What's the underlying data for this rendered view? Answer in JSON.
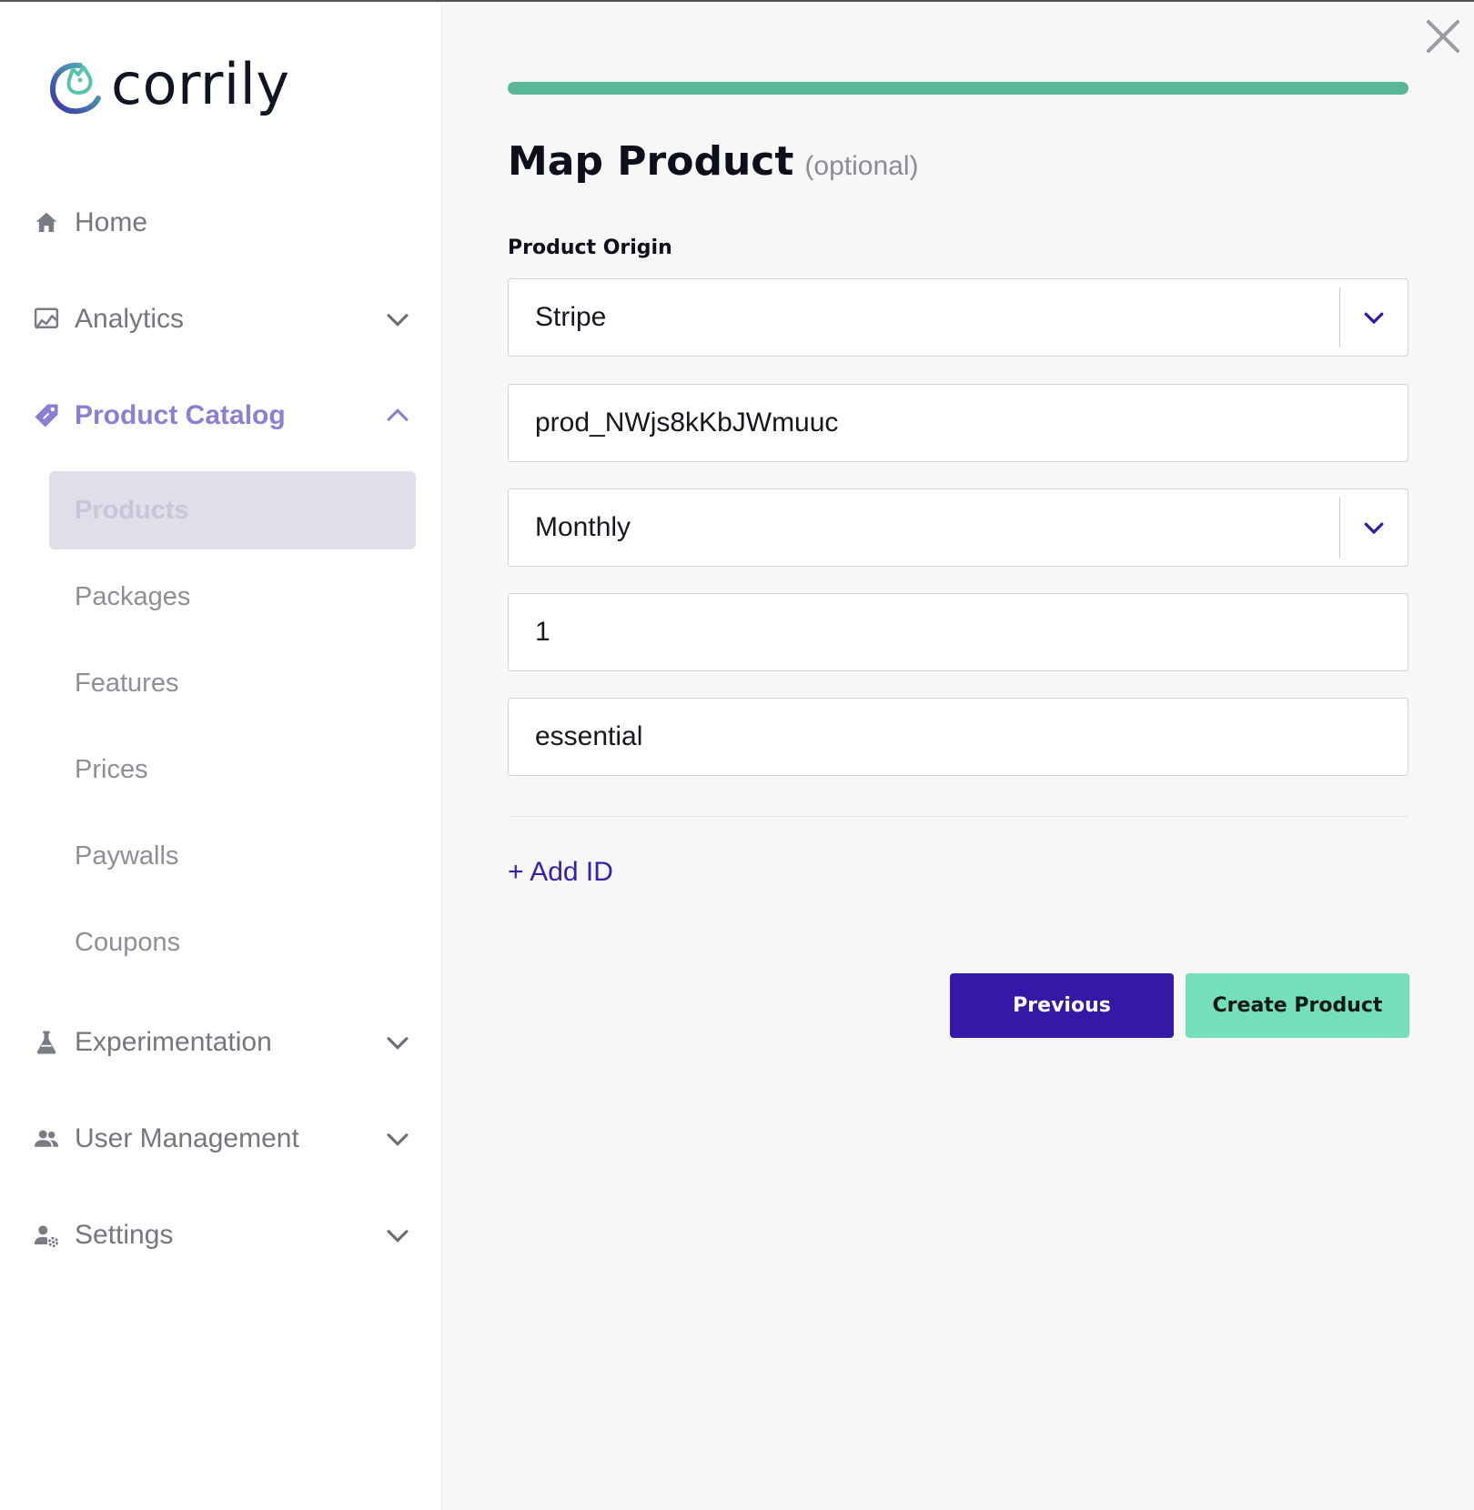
{
  "brand": {
    "name": "corrily"
  },
  "sidebar": {
    "items": [
      {
        "label": "Home",
        "icon": "home-icon"
      },
      {
        "label": "Analytics",
        "icon": "analytics-icon",
        "expanded": false
      },
      {
        "label": "Product Catalog",
        "icon": "tag-icon",
        "expanded": true,
        "active": true
      },
      {
        "label": "Experimentation",
        "icon": "flask-icon",
        "expanded": false
      },
      {
        "label": "User Management",
        "icon": "users-icon",
        "expanded": false
      },
      {
        "label": "Settings",
        "icon": "user-gear-icon",
        "expanded": false
      }
    ],
    "sub_items": [
      {
        "label": "Products",
        "selected": true
      },
      {
        "label": "Packages"
      },
      {
        "label": "Features"
      },
      {
        "label": "Prices"
      },
      {
        "label": "Paywalls"
      },
      {
        "label": "Coupons"
      }
    ]
  },
  "wizard": {
    "progress_percent": 100,
    "title": "Map Product",
    "title_suffix": "(optional)",
    "origin_label": "Product Origin",
    "origin_value": "Stripe",
    "product_id": "prod_NWjs8kKbJWmuuc",
    "interval_value": "Monthly",
    "interval_count": "1",
    "plan_key": "essential",
    "add_id_label": "+ Add ID",
    "previous_label": "Previous",
    "create_label": "Create Product"
  },
  "colors": {
    "accent": "#3319a6",
    "success": "#74dfb8",
    "progress": "#58b796",
    "active_nav": "#8b7fd4"
  }
}
